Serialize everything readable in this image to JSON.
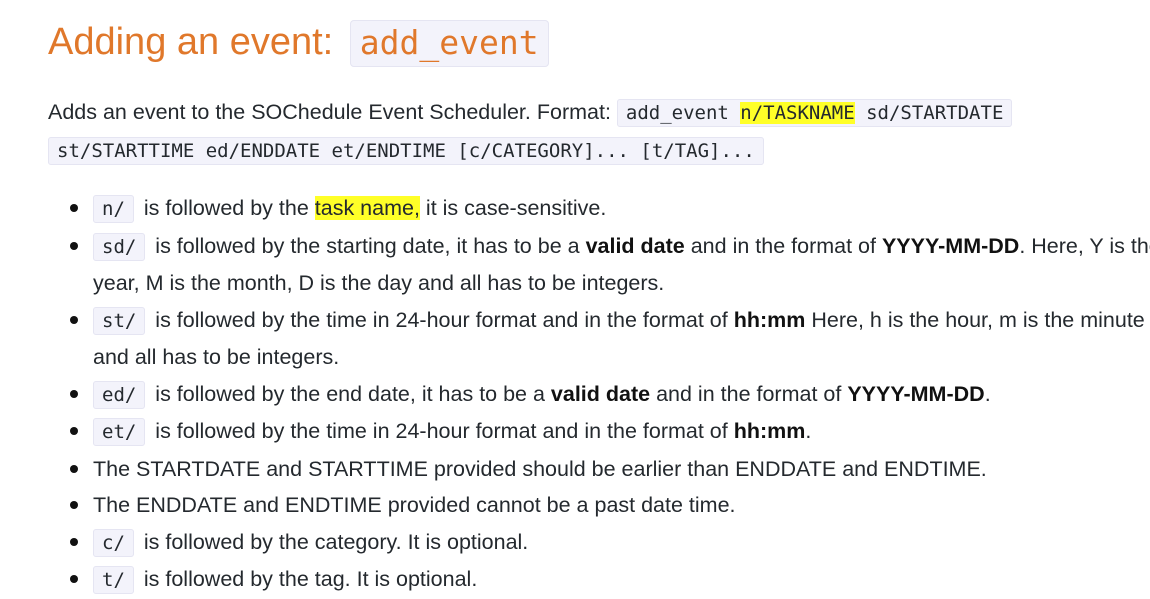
{
  "heading": {
    "text": "Adding an event: ",
    "code": "add_event"
  },
  "description": {
    "intro": "Adds an event to the SOChedule Event Scheduler. Format: ",
    "format_pre": "add_event ",
    "format_highlight": "n/TASKNAME",
    "format_post": " sd/STARTDATE st/STARTTIME ed/ENDDATE et/ENDTIME [c/CATEGORY]... [t/TAG]..."
  },
  "rules": [
    {
      "prefix": "n/",
      "text_pre": " is followed by the ",
      "text_highlight": "task name,",
      "text_post": " it is case-sensitive."
    },
    {
      "prefix": "sd/",
      "text_pre": " is followed by the starting date, it has to be a ",
      "bold1": "valid date",
      "text_mid": " and in the format of ",
      "bold2": "YYYY-MM-DD",
      "text_post": ". Here, Y is the year, M is the month, D is the day and all has to be integers."
    },
    {
      "prefix": "st/",
      "text_pre": " is followed by the time in 24-hour format and in the format of ",
      "bold1": "hh:mm",
      "text_post": " Here, h is the hour, m is the minute and all has to be integers."
    },
    {
      "prefix": "ed/",
      "text_pre": " is followed by the end date, it has to be a ",
      "bold1": "valid date",
      "text_mid": " and in the format of ",
      "bold2": "YYYY-MM-DD",
      "text_post": "."
    },
    {
      "prefix": "et/",
      "text_pre": " is followed by the time in 24-hour format and in the format of ",
      "bold1": "hh:mm",
      "text_post": "."
    },
    {
      "text": "The STARTDATE and STARTTIME provided should be earlier than ENDDATE and ENDTIME."
    },
    {
      "text": "The ENDDATE and ENDTIME provided cannot be a past date time."
    },
    {
      "prefix": "c/",
      "text_post": " is followed by the category. It is optional."
    },
    {
      "prefix": "t/",
      "text_post": " is followed by the tag. It is optional."
    }
  ],
  "colors": {
    "heading": "#e0782b",
    "highlight": "#ffff28",
    "code_background": "#f3f3fb",
    "text": "#24292e"
  }
}
